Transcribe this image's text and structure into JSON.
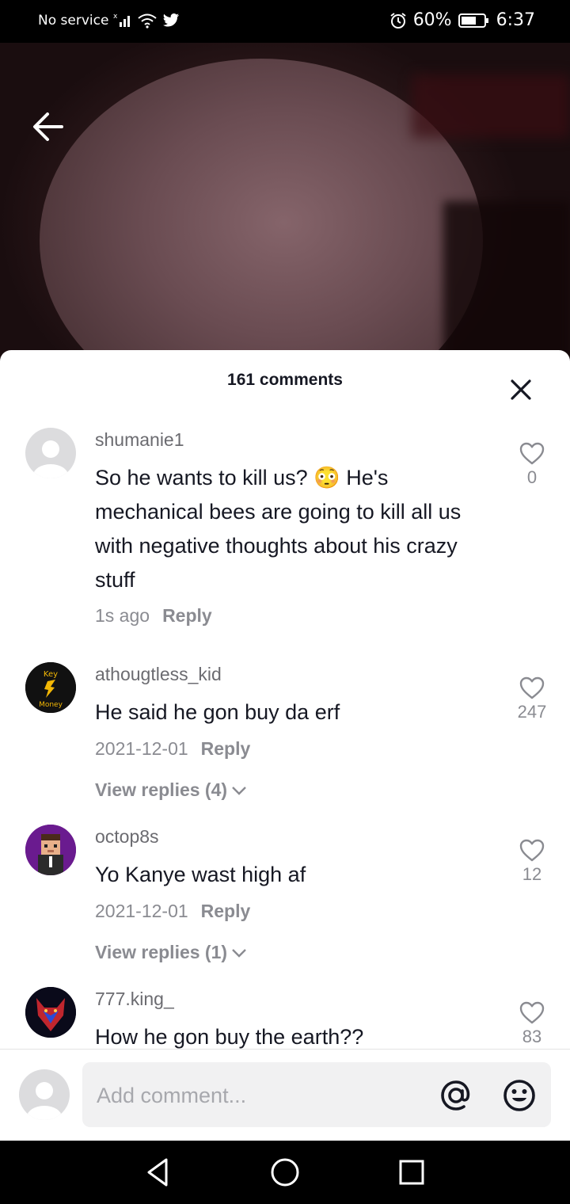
{
  "status_bar": {
    "carrier": "No service",
    "battery": "60%",
    "time": "6:37"
  },
  "comments_sheet": {
    "title": "161 comments",
    "comments": [
      {
        "username": "shumanie1",
        "text": "So he wants to kill us? 😳 He's mechanical bees are going to kill all us with negative thoughts about his crazy stuff",
        "time": "1s ago",
        "reply_label": "Reply",
        "likes": "0"
      },
      {
        "username": "athougtless_kid",
        "text": "He said he gon buy da erf",
        "time": "2021-12-01",
        "reply_label": "Reply",
        "likes": "247",
        "view_replies": "View replies (4)",
        "avatar_text_top": "Key",
        "avatar_text_bottom": "Money"
      },
      {
        "username": "octop8s",
        "text": "Yo Kanye wast high af",
        "time": "2021-12-01",
        "reply_label": "Reply",
        "likes": "12",
        "view_replies": "View replies (1)"
      },
      {
        "username": "777.king_",
        "text": "How he gon buy the earth??",
        "likes": "83"
      }
    ]
  },
  "composer": {
    "placeholder": "Add comment..."
  },
  "icons": {
    "back": "arrow-left-icon",
    "close": "close-icon",
    "like": "heart-outline-icon",
    "mention": "at-sign-icon",
    "emoji": "smiley-icon"
  },
  "colors": {
    "text_primary": "#161823",
    "text_secondary": "#8a8b91"
  }
}
